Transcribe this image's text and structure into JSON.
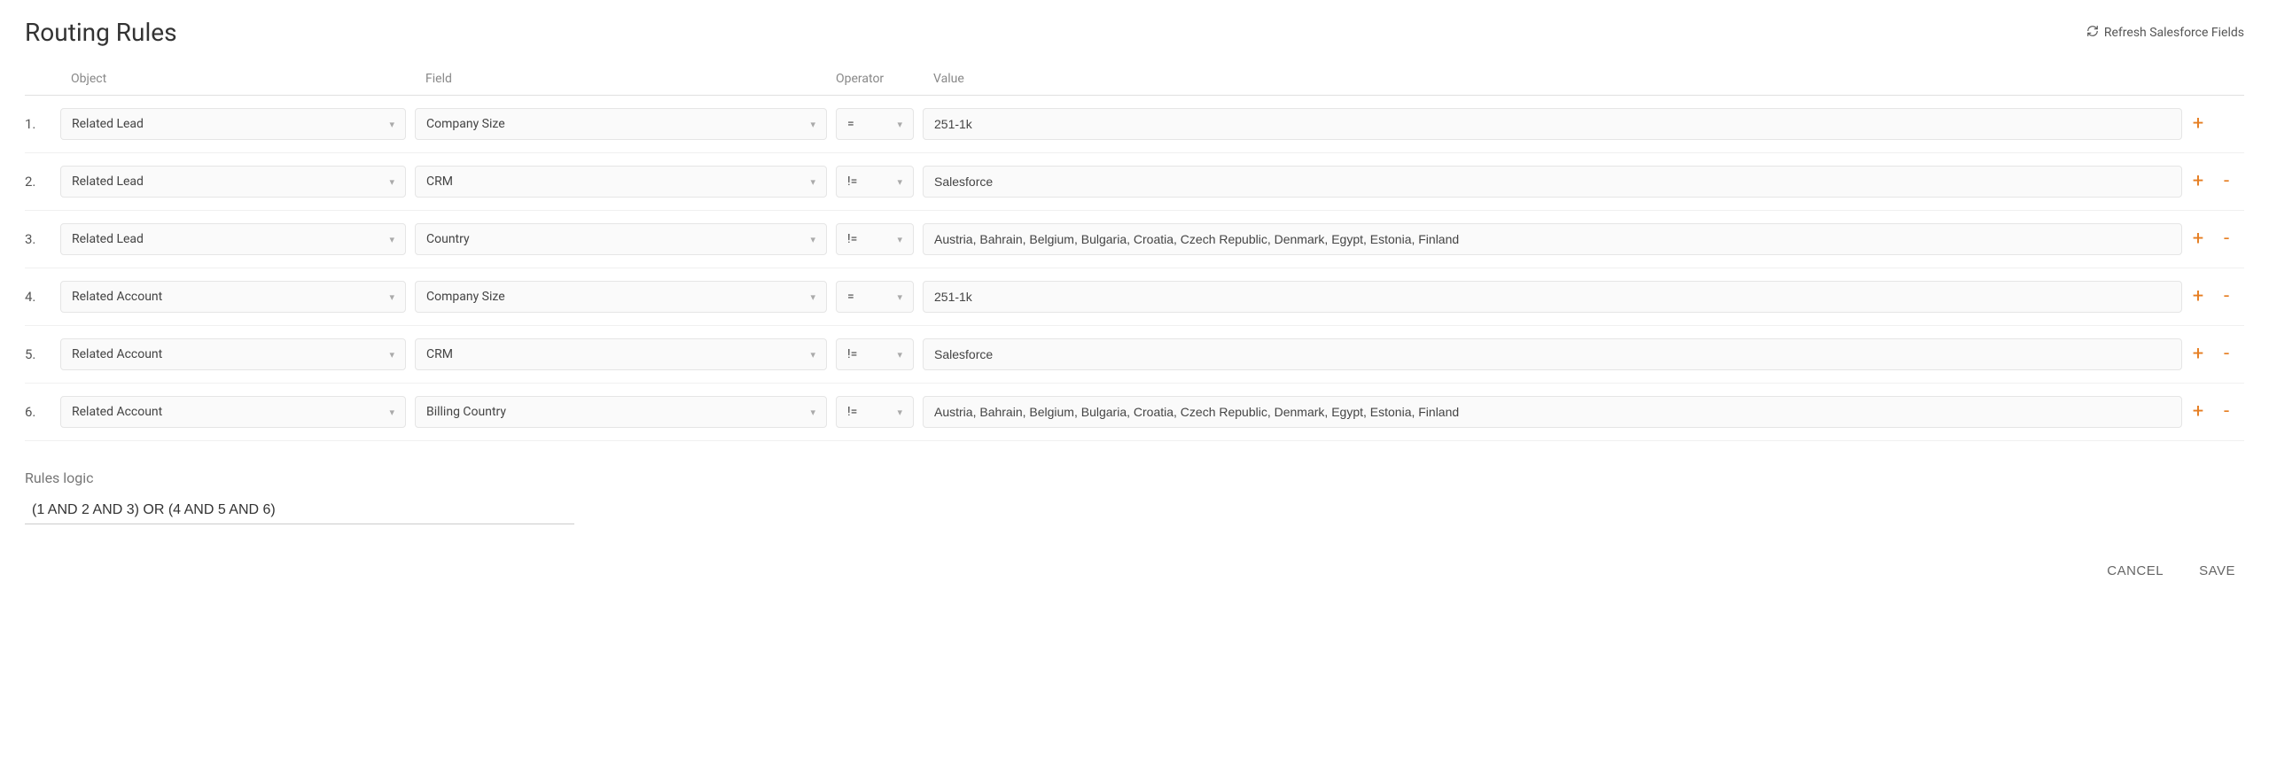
{
  "page": {
    "title": "Routing Rules",
    "refresh_label": "Refresh Salesforce Fields"
  },
  "columns": {
    "object": "Object",
    "field": "Field",
    "operator": "Operator",
    "value": "Value"
  },
  "rules": [
    {
      "num": "1.",
      "object": "Related Lead",
      "field": "Company Size",
      "operator": "=",
      "value": "251-1k",
      "can_remove": false
    },
    {
      "num": "2.",
      "object": "Related Lead",
      "field": "CRM",
      "operator": "!=",
      "value": "Salesforce",
      "can_remove": true
    },
    {
      "num": "3.",
      "object": "Related Lead",
      "field": "Country",
      "operator": "!=",
      "value": "Austria, Bahrain, Belgium, Bulgaria, Croatia, Czech Republic, Denmark, Egypt, Estonia, Finland",
      "can_remove": true
    },
    {
      "num": "4.",
      "object": "Related Account",
      "field": "Company Size",
      "operator": "=",
      "value": "251-1k",
      "can_remove": true
    },
    {
      "num": "5.",
      "object": "Related Account",
      "field": "CRM",
      "operator": "!=",
      "value": "Salesforce",
      "can_remove": true
    },
    {
      "num": "6.",
      "object": "Related Account",
      "field": "Billing Country",
      "operator": "!=",
      "value": "Austria, Bahrain, Belgium, Bulgaria, Croatia, Czech Republic, Denmark, Egypt, Estonia, Finland",
      "can_remove": true
    }
  ],
  "rules_logic": {
    "label": "Rules logic",
    "value": "(1 AND 2 AND 3) OR (4 AND 5 AND 6)"
  },
  "buttons": {
    "cancel": "CANCEL",
    "save": "SAVE"
  }
}
